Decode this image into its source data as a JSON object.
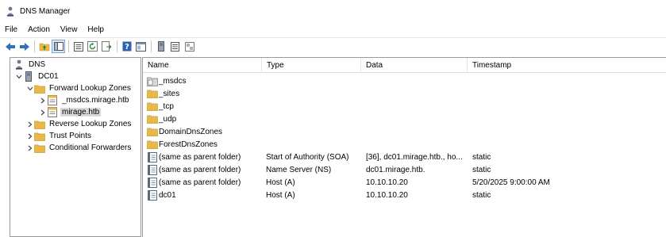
{
  "window": {
    "title": "DNS Manager"
  },
  "menu": [
    "File",
    "Action",
    "View",
    "Help"
  ],
  "toolbar": {
    "buttons": [
      "back-icon",
      "forward-icon",
      "up-folder-icon",
      "show-hide-tree-icon",
      "properties-icon",
      "refresh-icon",
      "export-list-icon",
      "help-icon",
      "console-icon",
      "server-icon",
      "list-icon",
      "zone-icon"
    ]
  },
  "tree": [
    {
      "label": "DNS",
      "icon": "dns-icon",
      "chevron": "",
      "indent": 0
    },
    {
      "label": "DC01",
      "icon": "server-icon",
      "chevron": "v",
      "indent": 1
    },
    {
      "label": "Forward Lookup Zones",
      "icon": "folder-icon",
      "chevron": "v",
      "indent": 2
    },
    {
      "label": "_msdcs.mirage.htb",
      "icon": "zone-icon",
      "chevron": ">",
      "indent": 3
    },
    {
      "label": "mirage.htb",
      "icon": "zone-icon",
      "chevron": ">",
      "indent": 3,
      "selected": true
    },
    {
      "label": "Reverse Lookup Zones",
      "icon": "folder-icon",
      "chevron": ">",
      "indent": 2
    },
    {
      "label": "Trust Points",
      "icon": "folder-icon",
      "chevron": ">",
      "indent": 2
    },
    {
      "label": "Conditional Forwarders",
      "icon": "folder-icon",
      "chevron": ">",
      "indent": 2
    }
  ],
  "list": {
    "columns": [
      "Name",
      "Type",
      "Data",
      "Timestamp"
    ],
    "rows": [
      {
        "name": "_msdcs",
        "type": "",
        "data": "",
        "timestamp": "",
        "icon": "delegated-folder-icon"
      },
      {
        "name": "_sites",
        "type": "",
        "data": "",
        "timestamp": "",
        "icon": "folder-icon"
      },
      {
        "name": "_tcp",
        "type": "",
        "data": "",
        "timestamp": "",
        "icon": "folder-icon"
      },
      {
        "name": "_udp",
        "type": "",
        "data": "",
        "timestamp": "",
        "icon": "folder-icon"
      },
      {
        "name": "DomainDnsZones",
        "type": "",
        "data": "",
        "timestamp": "",
        "icon": "folder-icon"
      },
      {
        "name": "ForestDnsZones",
        "type": "",
        "data": "",
        "timestamp": "",
        "icon": "folder-icon"
      },
      {
        "name": "(same as parent folder)",
        "type": "Start of Authority (SOA)",
        "data": "[36], dc01.mirage.htb., ho...",
        "timestamp": "static",
        "icon": "record-icon"
      },
      {
        "name": "(same as parent folder)",
        "type": "Name Server (NS)",
        "data": "dc01.mirage.htb.",
        "timestamp": "static",
        "icon": "record-icon"
      },
      {
        "name": "(same as parent folder)",
        "type": "Host (A)",
        "data": "10.10.10.20",
        "timestamp": "5/20/2025 9:00:00 AM",
        "icon": "record-icon"
      },
      {
        "name": "dc01",
        "type": "Host (A)",
        "data": "10.10.10.20",
        "timestamp": "static",
        "icon": "record-icon"
      }
    ]
  },
  "colors": {
    "folder": "#e8b948",
    "folder_dark": "#c99a2e",
    "record": "#5a6b7d",
    "back": "#2f6fbf",
    "forward": "#2f6fbf"
  }
}
